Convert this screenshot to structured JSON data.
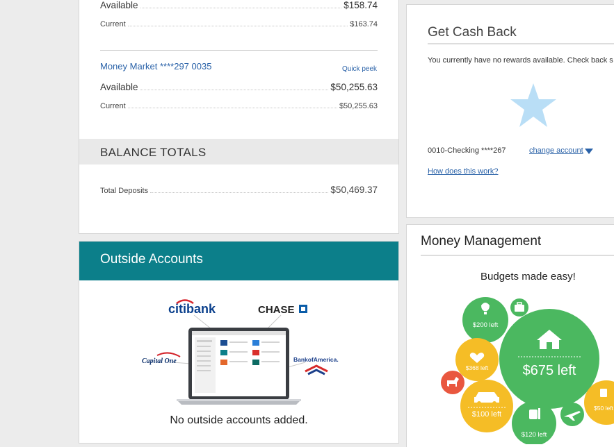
{
  "accounts": {
    "first": {
      "available_label": "Available",
      "available_value": "$158.74",
      "current_label": "Current",
      "current_value": "$163.74"
    },
    "money_market": {
      "name": "Money Market ****297   0035",
      "quick_peek": "Quick peek",
      "available_label": "Available",
      "available_value": "$50,255.63",
      "current_label": "Current",
      "current_value": "$50,255.63"
    },
    "totals": {
      "heading": "BALANCE TOTALS",
      "deposits_label": "Total Deposits",
      "deposits_value": "$50,469.37"
    }
  },
  "outside": {
    "title": "Outside Accounts",
    "logos": {
      "citibank": "citibank",
      "chase": "CHASE",
      "capital_one": "Capital One",
      "bank_of_america": "BankofAmerica."
    },
    "empty_message": "No outside accounts added."
  },
  "cashback": {
    "title": "Get Cash Back",
    "message": "You currently have no rewards available. Check back s",
    "account": "0010-Checking ****267",
    "change_account": "change account",
    "how_link": "How does this work?"
  },
  "money_management": {
    "title": "Money Management",
    "subtitle": "Budgets made easy!",
    "bubbles": {
      "green_top": "$200 left",
      "yellow_mid": "$368 left",
      "big_green": "$675 left",
      "yellow_car": "$100 left",
      "green_bottom": "$120 left",
      "yellow_right": "$50 left"
    }
  },
  "colors": {
    "teal": "#0c7f8a",
    "link": "#2a62a8",
    "bubble_green": "#4bb860",
    "bubble_yellow": "#f5bd26",
    "bubble_red": "#e9573f",
    "star": "#b9def6"
  }
}
